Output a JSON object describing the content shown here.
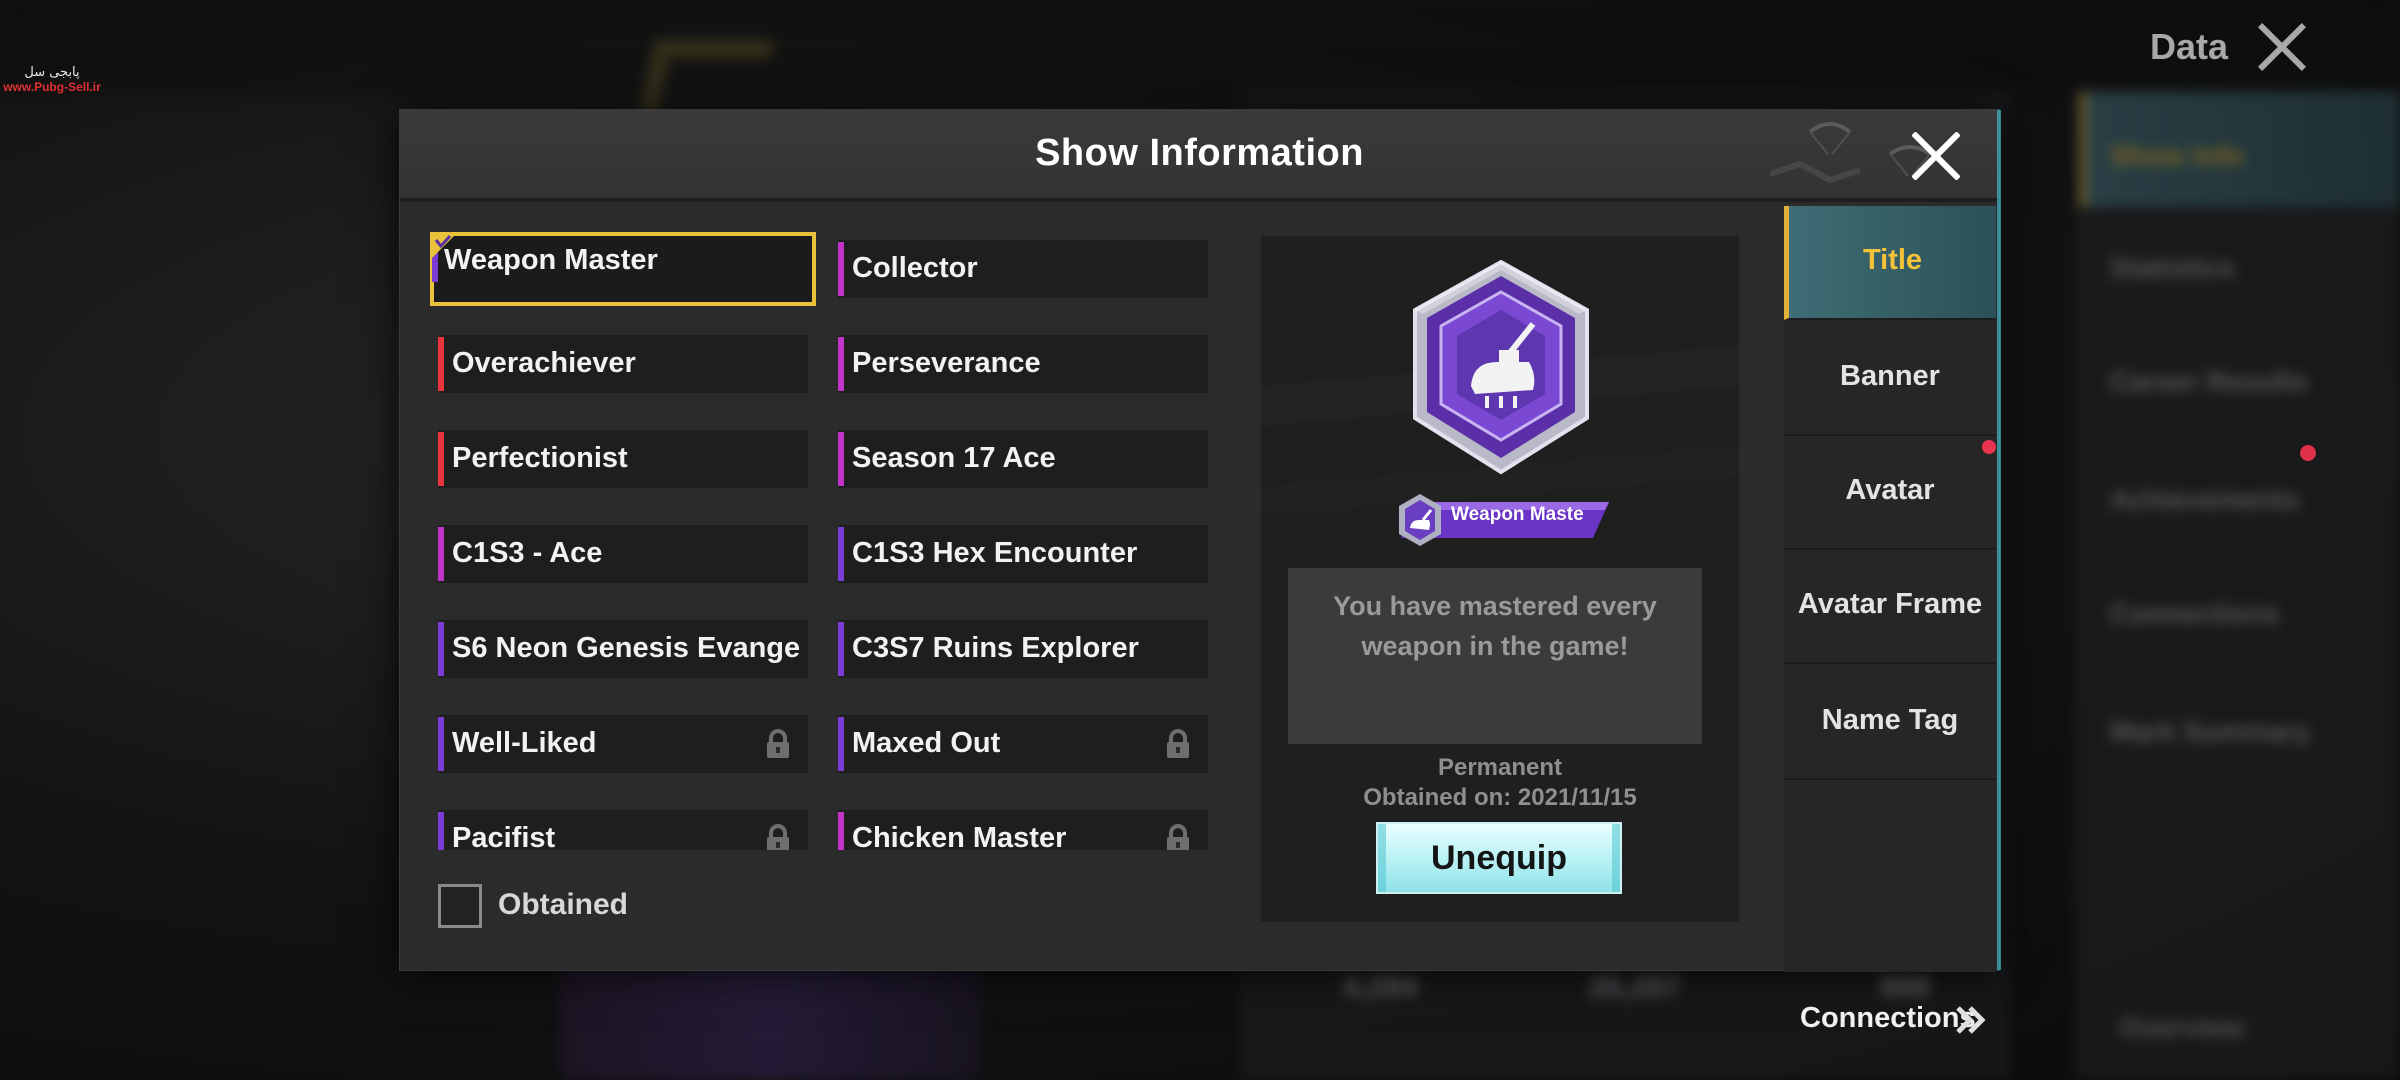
{
  "watermark": {
    "line1": "پابجی سل",
    "line2": "www.Pubg-Sell.ir"
  },
  "background": {
    "top_right_label": "Data",
    "sidebar_items": [
      "Show Info",
      "Statistics",
      "Career Results",
      "Achievements",
      "Connections",
      "Mark Summary"
    ],
    "stats": [
      "4,284",
      "26,287",
      "888"
    ],
    "bottom_right_label": "Overview"
  },
  "modal": {
    "title": "Show Information",
    "close_icon": "close-icon"
  },
  "titles": [
    {
      "label": "Weapon Master",
      "bar_color": "#7a3bd6",
      "locked": false,
      "selected": true
    },
    {
      "label": "Collector",
      "bar_color": "#c035c8",
      "locked": false,
      "selected": false
    },
    {
      "label": "Overachiever",
      "bar_color": "#e8343c",
      "locked": false,
      "selected": false
    },
    {
      "label": "Perseverance",
      "bar_color": "#c035c8",
      "locked": false,
      "selected": false
    },
    {
      "label": "Perfectionist",
      "bar_color": "#e8343c",
      "locked": false,
      "selected": false
    },
    {
      "label": "Season 17 Ace",
      "bar_color": "#c035c8",
      "locked": false,
      "selected": false
    },
    {
      "label": "C1S3 - Ace",
      "bar_color": "#c035c8",
      "locked": false,
      "selected": false
    },
    {
      "label": "C1S3 Hex Encounter",
      "bar_color": "#7a3bd6",
      "locked": false,
      "selected": false
    },
    {
      "label": "S6 Neon Genesis Evange",
      "bar_color": "#7a3bd6",
      "locked": false,
      "selected": false
    },
    {
      "label": "C3S7 Ruins Explorer",
      "bar_color": "#7a3bd6",
      "locked": false,
      "selected": false
    },
    {
      "label": "Well-Liked",
      "bar_color": "#7a3bd6",
      "locked": true,
      "selected": false
    },
    {
      "label": "Maxed Out",
      "bar_color": "#7a3bd6",
      "locked": true,
      "selected": false
    },
    {
      "label": "Pacifist",
      "bar_color": "#7a3bd6",
      "locked": true,
      "selected": false
    },
    {
      "label": "Chicken Master",
      "bar_color": "#c035c8",
      "locked": true,
      "selected": false
    }
  ],
  "filter": {
    "label": "Obtained",
    "checked": false
  },
  "detail": {
    "ribbon_name": "Weapon Maste",
    "description": "You have mastered every weapon in the game!",
    "duration": "Permanent",
    "obtained_on": "Obtained on: 2021/11/15",
    "action_label": "Unequip",
    "badge_color": "#7a3bd6"
  },
  "tabs": [
    {
      "label": "Title",
      "active": true
    },
    {
      "label": "Banner",
      "active": false
    },
    {
      "label": "Avatar",
      "active": false
    },
    {
      "label": "Avatar Frame",
      "active": false
    },
    {
      "label": "Name Tag",
      "active": false
    }
  ],
  "connections": {
    "label": "Connections",
    "icon": "double-chevron-right-icon"
  },
  "colors": {
    "accent_gold": "#e8c23a",
    "active_tab": "#3f6d75",
    "button": "#b6f1f4"
  }
}
